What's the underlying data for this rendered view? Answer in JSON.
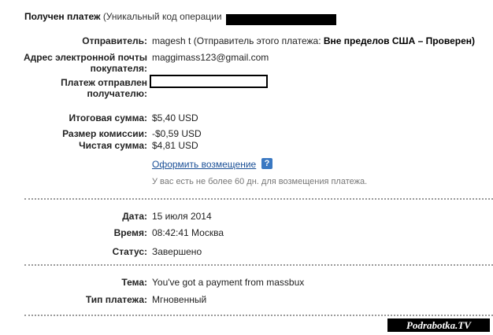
{
  "header": {
    "title": "Получен платеж",
    "subtitle": "(Уникальный код операции"
  },
  "fields": {
    "sender_label": "Отправитель:",
    "sender_value": "magesh t (Отправитель этого платежа: ",
    "sender_status": "Вне пределов США – Проверен)",
    "email_label_1": "Адрес электронной почты",
    "email_label_2": "покупателя:",
    "email_value": "maggimass123@gmail.com",
    "sent_to_label_1": "Платеж отправлен",
    "sent_to_label_2": "получателю:",
    "total_label": "Итоговая сумма:",
    "total_value": "$5,40 USD",
    "fee_label": "Размер комиссии:",
    "fee_value": "-$0,59 USD",
    "net_label": "Чистая сумма:",
    "net_value": "$4,81 USD",
    "refund_link": "Оформить возмещение",
    "help_icon": "?",
    "refund_note": "У вас есть не более 60 дн. для возмещения платежа.",
    "date_label": "Дата:",
    "date_value": "15 июля 2014",
    "time_label": "Время:",
    "time_value": "08:42:41 Москва",
    "status_label": "Статус:",
    "status_value": "Завершено",
    "subject_label": "Тема:",
    "subject_value": "You've got a payment from massbux",
    "type_label": "Тип платежа:",
    "type_value": "Мгновенный"
  },
  "watermark": "Podrabotka.TV",
  "colors": {
    "link": "#1a4f96",
    "help": "#3a78c2"
  }
}
